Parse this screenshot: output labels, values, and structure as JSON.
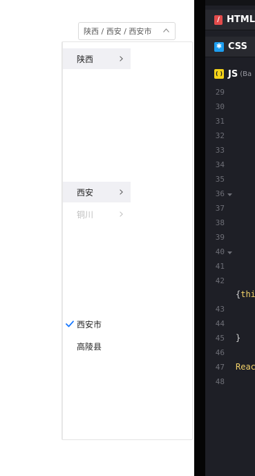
{
  "cascader": {
    "value": "陕西 / 西安 / 西安市",
    "options": {
      "level1": [
        {
          "label": "陕西",
          "has_children": true,
          "active": true
        }
      ],
      "level2": [
        {
          "label": "西安",
          "has_children": true,
          "active": true,
          "disabled": false
        },
        {
          "label": "铜川",
          "has_children": true,
          "active": false,
          "disabled": true
        }
      ],
      "level3": [
        {
          "label": "西安市",
          "selected": true
        },
        {
          "label": "高陵县",
          "selected": false
        }
      ]
    }
  },
  "editor": {
    "tabs": [
      {
        "badge": "/",
        "label": "HTML"
      },
      {
        "badge": "✱",
        "label": "CSS"
      },
      {
        "badge": "( )",
        "label": "JS",
        "sub": "(Ba"
      }
    ],
    "line_numbers": [
      "29",
      "30",
      "31",
      "32",
      "33",
      "34",
      "35",
      "36",
      "37",
      "38",
      "39",
      "40",
      "41",
      "42",
      "43",
      "44",
      "45",
      "46",
      "47",
      "48"
    ],
    "code_lines": [
      {
        "text_prefix": "{",
        "text_highlight": "thi"
      },
      {
        "text_prefix": "}",
        "text_highlight": ""
      },
      {
        "text_prefix": "",
        "text_highlight": "Reac"
      }
    ]
  },
  "colors": {
    "accent_check": "#1677ff",
    "editor_bg": "#1e1f26",
    "html_badge": "#e34b4b",
    "css_badge": "#1d9ef0",
    "js_badge": "#f5d319"
  }
}
